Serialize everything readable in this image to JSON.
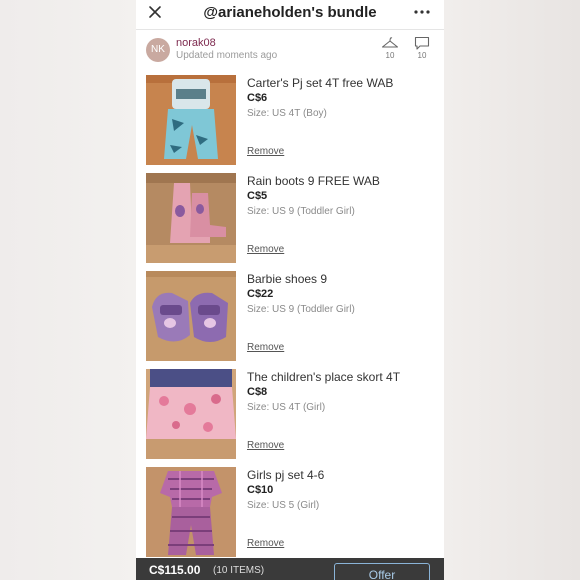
{
  "header": {
    "title": "@arianeholden's bundle",
    "close_icon": "close-icon",
    "more_icon": "more-options-icon"
  },
  "seller": {
    "initials": "NK",
    "username": "norak08",
    "updated": "Updated moments ago",
    "likes_count": "10",
    "comments_count": "10"
  },
  "items": [
    {
      "title": "Carter's Pj set 4T free WAB",
      "price": "C$6",
      "size": "Size: US 4T (Boy)",
      "remove_label": "Remove"
    },
    {
      "title": "Rain boots 9 FREE WAB",
      "price": "C$5",
      "size": "Size: US 9 (Toddler Girl)",
      "remove_label": "Remove"
    },
    {
      "title": "Barbie shoes 9",
      "price": "C$22",
      "size": "Size: US 9 (Toddler Girl)",
      "remove_label": "Remove"
    },
    {
      "title": "The children's place skort 4T",
      "price": "C$8",
      "size": "Size: US 4T (Girl)",
      "remove_label": "Remove"
    },
    {
      "title": "Girls pj set 4-6",
      "price": "C$10",
      "size": "Size: US 5 (Girl)",
      "remove_label": "Remove"
    }
  ],
  "footer": {
    "total": "C$115.00",
    "count": "(10 ITEMS)",
    "offer_label": "Offer"
  },
  "colors": {
    "username": "#7d2a4f",
    "footer_bg": "#3a3a3a",
    "offer_border": "#8ab4d8"
  }
}
